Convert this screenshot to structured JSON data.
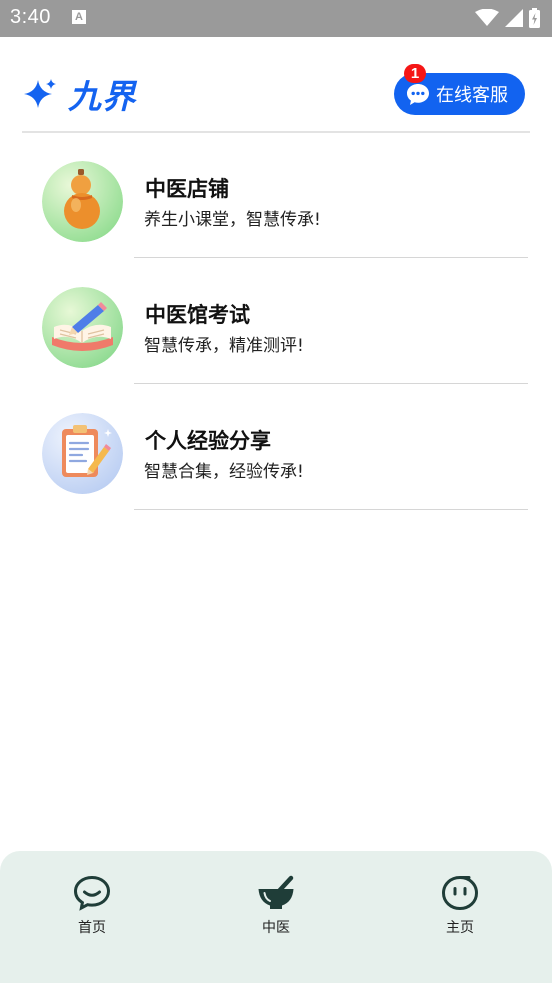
{
  "status_bar": {
    "time": "3:40",
    "notification_icon": "text-a-icon",
    "icons": [
      "wifi-icon",
      "signal-icon",
      "battery-charging-icon"
    ]
  },
  "header": {
    "brand_icon": "sparkle-icon",
    "brand_name": "九界",
    "service_button": {
      "icon": "chat-bubble-icon",
      "label": "在线客服",
      "badge": "1"
    }
  },
  "menu": {
    "items": [
      {
        "title": "中医店铺",
        "subtitle": "养生小课堂，智慧传承!",
        "icon": "gourd-icon"
      },
      {
        "title": "中医馆考试",
        "subtitle": "智慧传承，精准测评!",
        "icon": "open-book-pencil-icon"
      },
      {
        "title": "个人经验分享",
        "subtitle": "智慧合集，经验传承!",
        "icon": "clipboard-pencil-icon"
      }
    ]
  },
  "bottom_nav": {
    "items": [
      {
        "label": "首页",
        "icon": "smile-chat-icon",
        "active": false
      },
      {
        "label": "中医",
        "icon": "mortar-pestle-icon",
        "active": true
      },
      {
        "label": "主页",
        "icon": "face-icon",
        "active": false
      }
    ]
  },
  "colors": {
    "brand_blue": "#1263f0",
    "badge_red": "#f51616",
    "nav_bg": "#e6f0ec",
    "nav_icon": "#1f3d38",
    "status_bar": "#9a9a9a"
  }
}
